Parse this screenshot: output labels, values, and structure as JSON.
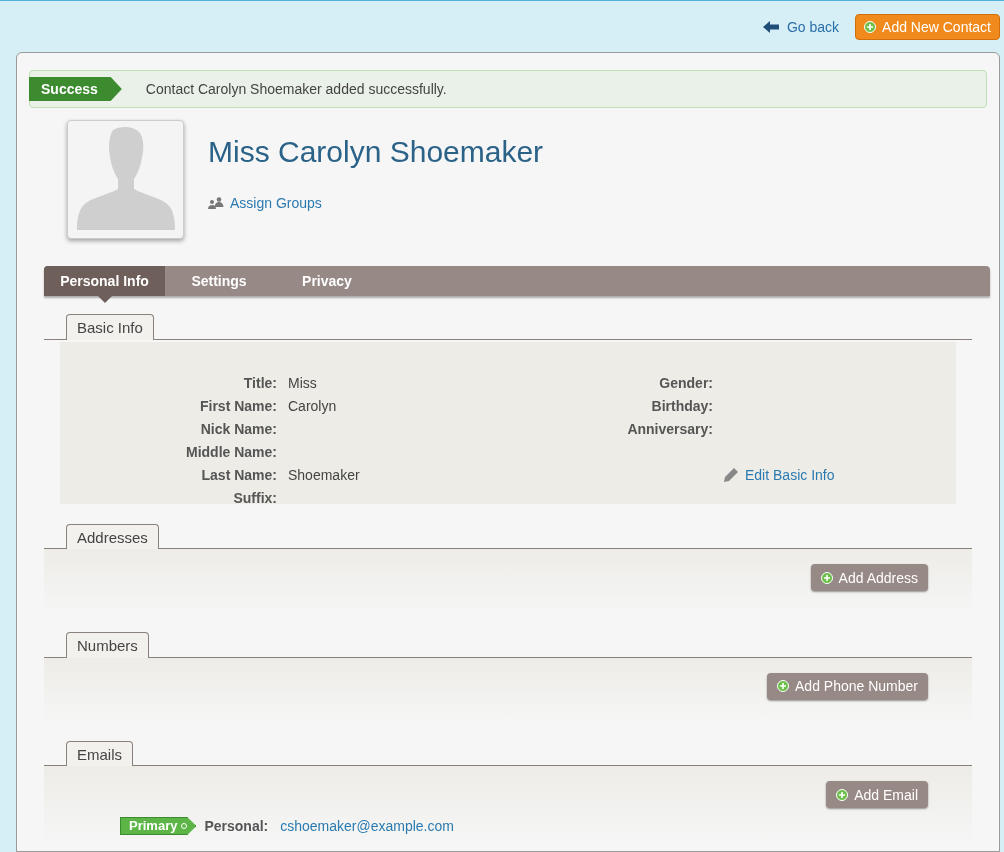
{
  "header": {
    "back_link": "Go back",
    "add_button": "Add New Contact"
  },
  "alert": {
    "kind": "success",
    "badge": "Success",
    "message": "Contact Carolyn Shoemaker added successfully."
  },
  "contact": {
    "name": "Miss Carolyn Shoemaker",
    "assign_groups": "Assign Groups"
  },
  "tabs": [
    {
      "label": "Personal Info",
      "selected": true
    },
    {
      "label": "Settings",
      "selected": false
    },
    {
      "label": "Privacy",
      "selected": false
    }
  ],
  "basic_info": {
    "title": "Basic Info",
    "edit_link": "Edit Basic Info",
    "left_fields": [
      {
        "label": "Title:",
        "value": "Miss"
      },
      {
        "label": "First Name:",
        "value": "Carolyn"
      },
      {
        "label": "Nick Name:"
      },
      {
        "label": "Middle Name:"
      },
      {
        "label": "Last Name:",
        "value": "Shoemaker"
      },
      {
        "label": "Suffix:"
      }
    ],
    "right_fields": [
      {
        "label": "Gender:"
      },
      {
        "label": "Birthday:"
      },
      {
        "label": "Anniversary:"
      }
    ]
  },
  "sections": [
    {
      "title": "Addresses",
      "button": "Add Address"
    },
    {
      "title": "Numbers",
      "button": "Add Phone Number"
    }
  ],
  "emails": {
    "title": "Emails",
    "button": "Add Email",
    "items": [
      {
        "primary": true,
        "badge": "Primary",
        "label": "Personal:",
        "address": "cshoemaker@example.com"
      }
    ]
  }
}
